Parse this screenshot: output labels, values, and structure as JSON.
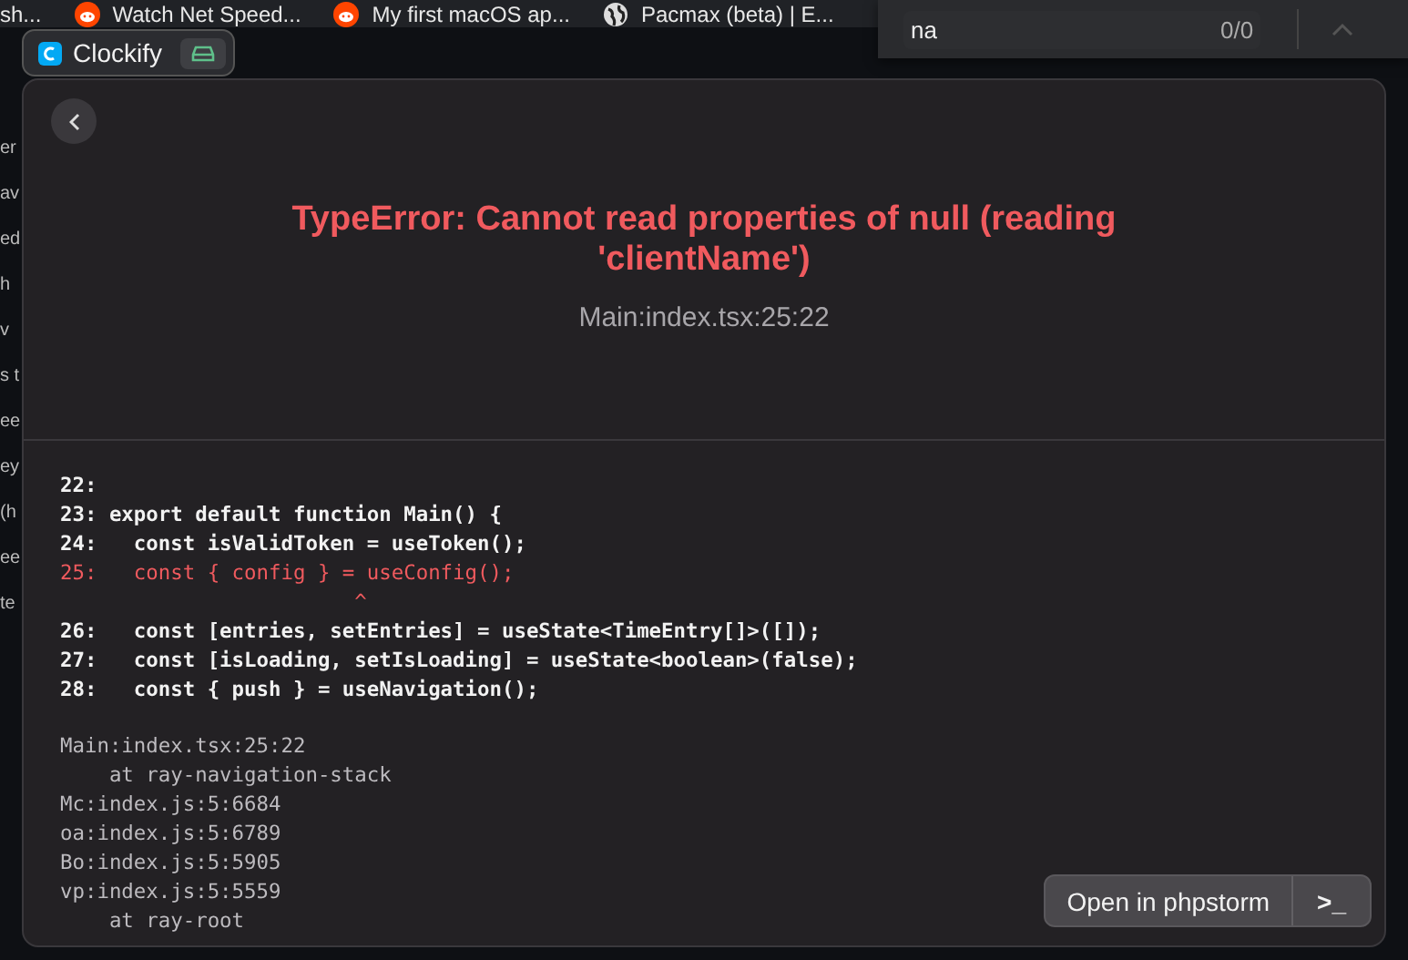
{
  "bookmarks_bar": {
    "items": [
      {
        "label": "sh...",
        "kind": "plain"
      },
      {
        "label": "Watch Net Speed...",
        "kind": "reddit"
      },
      {
        "label": "My first macOS ap...",
        "kind": "reddit"
      },
      {
        "label": "Pacmax (beta) | E...",
        "kind": "globe"
      }
    ]
  },
  "find_bar": {
    "value": "na",
    "count": "0/0"
  },
  "app_tab": {
    "title": "Clockify"
  },
  "background_fragments": [
    "er",
    "av",
    "ed",
    "h",
    "v",
    "s t",
    "ee",
    "ey",
    "(h",
    "ee",
    "te"
  ],
  "error": {
    "title": "TypeError: Cannot read properties of null (reading 'clientName')",
    "location": "Main:index.tsx:25:22"
  },
  "code_lines": [
    {
      "number": "22:",
      "highlighted": false
    },
    {
      "number": "23:",
      "code": "export default function Main() {",
      "highlighted": false
    },
    {
      "number": "24:",
      "code": "  const isValidToken = useToken();",
      "highlighted": false
    },
    {
      "number": "25:",
      "code": "  const { config } = useConfig();",
      "highlighted": true,
      "caret": "                    ^"
    },
    {
      "number": "26:",
      "code": "  const [entries, setEntries] = useState<TimeEntry[]>([]);",
      "highlighted": false
    },
    {
      "number": "27:",
      "code": "  const [isLoading, setIsLoading] = useState<boolean>(false);",
      "highlighted": false
    },
    {
      "number": "28:",
      "code": "  const { push } = useNavigation();",
      "highlighted": false
    }
  ],
  "stack_trace": [
    "Main:index.tsx:25:22",
    "    at ray-navigation-stack",
    "Mc:index.js:5:6684",
    "oa:index.js:5:6789",
    "Bo:index.js:5:5905",
    "vp:index.js:5:5559",
    "    at ray-root"
  ],
  "actions": {
    "primary": "Open in phpstorm",
    "secondary": ">_"
  }
}
